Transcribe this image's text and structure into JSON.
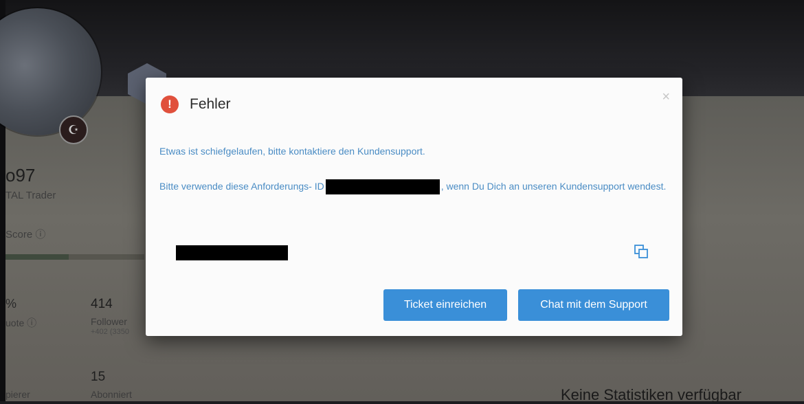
{
  "background": {
    "username": "o97",
    "role": "TAL Trader",
    "score_label": "Score ⓘ",
    "pct_label": "%",
    "quote_label": "uote ⓘ",
    "followers_count": "414",
    "followers_label": "Follower",
    "followers_sub": "+402 (3350",
    "subscribed_count": "15",
    "subscribed_label": "Abonniert",
    "copy_label": "pierer",
    "no_stats": "Keine Statistiken verfügbar"
  },
  "modal": {
    "icon": "error-exclamation-icon",
    "icon_glyph": "!",
    "title": "Fehler",
    "close_glyph": "×",
    "message_1": "Etwas ist schiefgelaufen, bitte kontaktiere den Kundensupport.",
    "message_2_before": "Bitte verwende diese Anforderungs- ID",
    "message_2_after": ", wenn Du Dich an unseren Kundensupport wendest.",
    "copy_icon": "copy-icon",
    "buttons": {
      "ticket": "Ticket einreichen",
      "chat": "Chat mit dem Support"
    }
  },
  "colors": {
    "error": "#e0503c",
    "link_text": "#4a8cc4",
    "button": "#3a8fd8"
  }
}
